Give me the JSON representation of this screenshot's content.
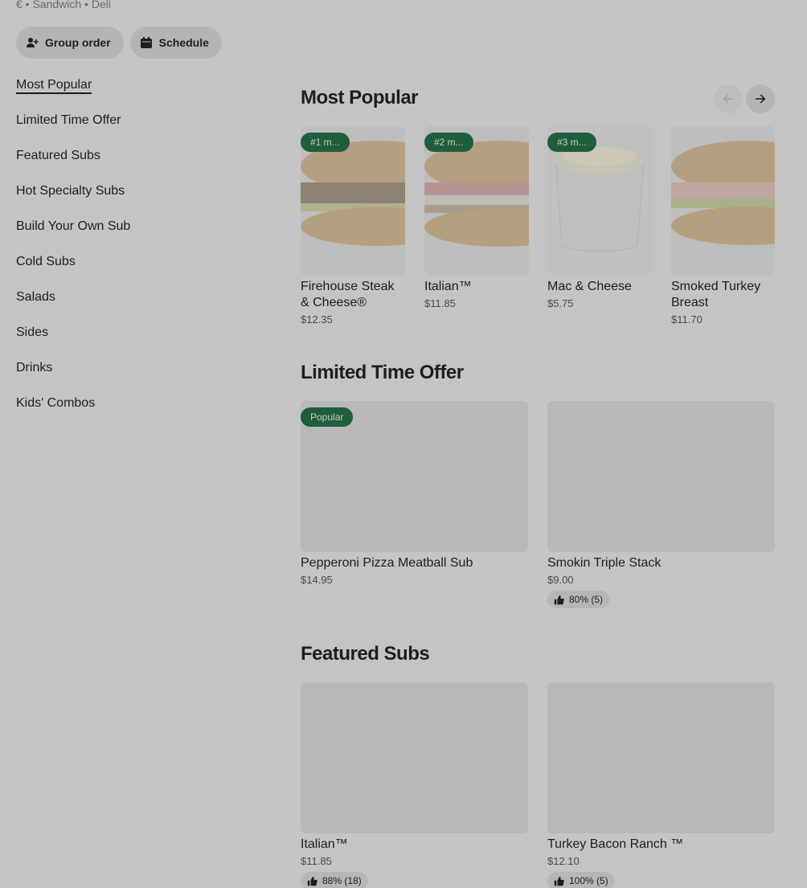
{
  "store": {
    "meta": "€ • Sandwich • Deli"
  },
  "actions": {
    "group_order": "Group order",
    "schedule": "Schedule"
  },
  "sidebar": {
    "items": [
      {
        "label": "Most Popular"
      },
      {
        "label": "Limited Time Offer"
      },
      {
        "label": "Featured Subs"
      },
      {
        "label": "Hot Specialty Subs"
      },
      {
        "label": "Build Your Own Sub"
      },
      {
        "label": "Cold Subs"
      },
      {
        "label": "Salads"
      },
      {
        "label": "Sides"
      },
      {
        "label": "Drinks"
      },
      {
        "label": "Kids' Combos"
      }
    ]
  },
  "sections": {
    "most_popular": {
      "title": "Most Popular",
      "items": [
        {
          "badge": "#1 m...",
          "name": "Firehouse Steak & Cheese®",
          "price": "$12.35"
        },
        {
          "badge": "#2 m...",
          "name": "Italian™",
          "price": "$11.85"
        },
        {
          "badge": "#3 m...",
          "name": "Mac & Cheese",
          "price": "$5.75"
        },
        {
          "badge": "",
          "name": "Smoked Turkey Breast",
          "price": "$11.70"
        }
      ]
    },
    "limited": {
      "title": "Limited Time Offer",
      "items": [
        {
          "badge": "Popular",
          "name": "Pepperoni Pizza Meatball Sub",
          "price": "$14.95",
          "rating": ""
        },
        {
          "badge": "",
          "name": "Smokin Triple Stack",
          "price": "$9.00",
          "rating": "80% (5)"
        }
      ]
    },
    "featured": {
      "title": "Featured Subs",
      "items": [
        {
          "name": "Italian™",
          "price": "$11.85",
          "rating": "88% (18)"
        },
        {
          "name": "Turkey Bacon Ranch ™",
          "price": "$12.10",
          "rating": "100% (5)"
        }
      ]
    }
  },
  "colors": {
    "badge_bg": "#1f5e3b",
    "overlay_bg": "#c4c4c4"
  },
  "icons": {
    "group_order": "add-person-icon",
    "schedule": "calendar-icon",
    "prev": "arrow-left-icon",
    "next": "arrow-right-icon",
    "rating": "thumbs-up-icon"
  }
}
